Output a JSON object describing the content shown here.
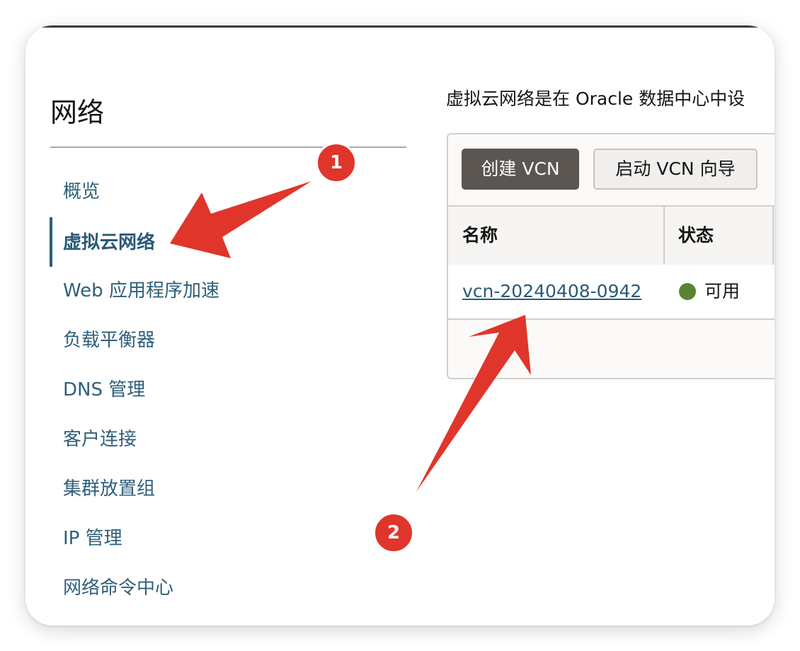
{
  "sidebar": {
    "title": "网络",
    "items": [
      {
        "label": "概览"
      },
      {
        "label": "虚拟云网络",
        "active": true
      },
      {
        "label": "Web 应用程序加速"
      },
      {
        "label": "负载平衡器"
      },
      {
        "label": "DNS 管理"
      },
      {
        "label": "客户连接"
      },
      {
        "label": "集群放置组"
      },
      {
        "label": "IP 管理"
      },
      {
        "label": "网络命令中心"
      }
    ]
  },
  "main": {
    "description": "虚拟云网络是在 Oracle 数据中心中设",
    "create_button_label": "创建 VCN",
    "wizard_button_label": "启动 VCN 向导",
    "table": {
      "columns": [
        "名称",
        "状态"
      ],
      "rows": [
        {
          "name": "vcn-20240408-0942",
          "status": "可用"
        }
      ]
    }
  },
  "annotations": {
    "badge_1": "1",
    "badge_2": "2"
  },
  "colors": {
    "accent": "#2c5f7c",
    "annotation_red": "#e0352b",
    "status_available": "#5a8435",
    "primary_button": "#5b5652"
  }
}
